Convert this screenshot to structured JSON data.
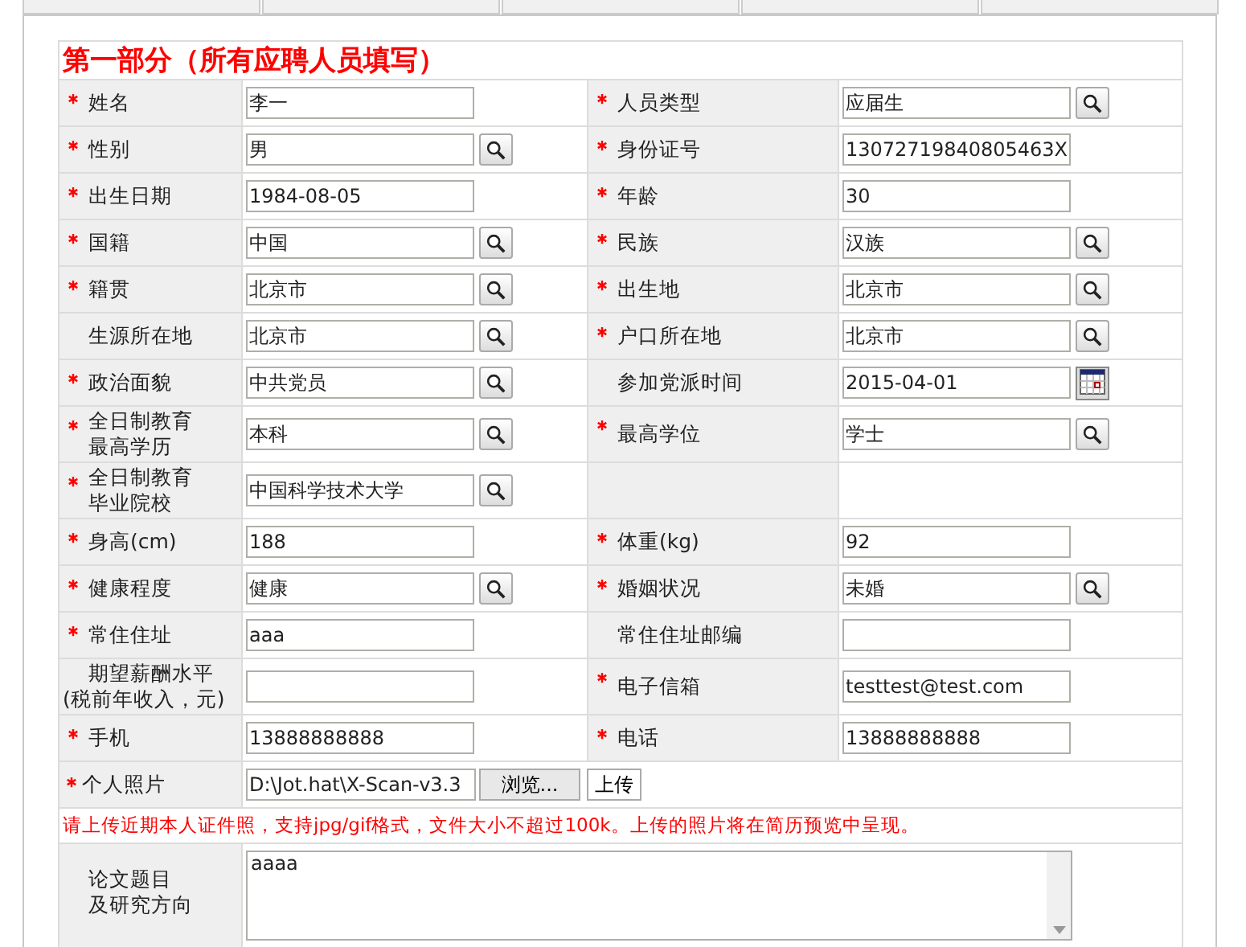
{
  "section_title": "第一部分（所有应聘人员填写）",
  "rows": [
    {
      "cells": [
        {
          "label": [
            "姓名"
          ],
          "required": true,
          "kind": "text",
          "value": "李一"
        },
        {
          "label": [
            "人员类型"
          ],
          "required": true,
          "kind": "lookup",
          "value": "应届生"
        }
      ]
    },
    {
      "cells": [
        {
          "label": [
            "性别"
          ],
          "required": true,
          "kind": "lookup",
          "value": "男"
        },
        {
          "label": [
            "身份证号"
          ],
          "required": true,
          "kind": "text",
          "value": "13072719840805463X"
        }
      ]
    },
    {
      "cells": [
        {
          "label": [
            "出生日期"
          ],
          "required": true,
          "kind": "text",
          "value": "1984-08-05"
        },
        {
          "label": [
            "年龄"
          ],
          "required": true,
          "kind": "text",
          "value": "30"
        }
      ]
    },
    {
      "cells": [
        {
          "label": [
            "国籍"
          ],
          "required": true,
          "kind": "lookup",
          "value": "中国"
        },
        {
          "label": [
            "民族"
          ],
          "required": true,
          "kind": "lookup",
          "value": "汉族"
        }
      ]
    },
    {
      "cells": [
        {
          "label": [
            "籍贯"
          ],
          "required": true,
          "kind": "lookup",
          "value": "北京市"
        },
        {
          "label": [
            "出生地"
          ],
          "required": true,
          "kind": "lookup",
          "value": "北京市"
        }
      ]
    },
    {
      "cells": [
        {
          "label": [
            "生源所在地"
          ],
          "required": false,
          "kind": "lookup",
          "value": "北京市"
        },
        {
          "label": [
            "户口所在地"
          ],
          "required": true,
          "kind": "lookup",
          "value": "北京市"
        }
      ]
    },
    {
      "cells": [
        {
          "label": [
            "政治面貌"
          ],
          "required": true,
          "kind": "lookup",
          "value": "中共党员"
        },
        {
          "label": [
            "参加党派时间"
          ],
          "required": false,
          "kind": "date",
          "value": "2015-04-01"
        }
      ]
    },
    {
      "cells": [
        {
          "label": [
            "全日制教育",
            "最高学历"
          ],
          "required": true,
          "kind": "lookup",
          "value": "本科"
        },
        {
          "label": [
            "最高学位"
          ],
          "required": true,
          "kind": "lookup",
          "value": "学士"
        }
      ]
    },
    {
      "cells": [
        {
          "label": [
            "全日制教育",
            "毕业院校"
          ],
          "required": true,
          "kind": "lookup",
          "value": "中国科学技术大学"
        },
        {
          "kind": "empty"
        }
      ]
    },
    {
      "cells": [
        {
          "label": [
            "身高(cm)"
          ],
          "required": true,
          "kind": "text",
          "value": "188"
        },
        {
          "label": [
            "体重(kg)"
          ],
          "required": true,
          "kind": "text",
          "value": "92"
        }
      ]
    },
    {
      "cells": [
        {
          "label": [
            "健康程度"
          ],
          "required": true,
          "kind": "lookup",
          "value": "健康"
        },
        {
          "label": [
            "婚姻状况"
          ],
          "required": true,
          "kind": "lookup",
          "value": "未婚"
        }
      ]
    },
    {
      "cells": [
        {
          "label": [
            "常住住址"
          ],
          "required": true,
          "kind": "text",
          "value": "aaa"
        },
        {
          "label": [
            "常住住址邮编"
          ],
          "required": false,
          "kind": "text"
        }
      ]
    },
    {
      "cells": [
        {
          "label": [
            "期望薪酬水平(税前年收入，元)"
          ],
          "required": false,
          "kind": "text"
        },
        {
          "label": [
            "电子信箱"
          ],
          "required": true,
          "kind": "text",
          "value": "testtest@test.com"
        }
      ]
    },
    {
      "cells": [
        {
          "label": [
            "手机"
          ],
          "required": true,
          "kind": "text",
          "value": "13888888888"
        },
        {
          "label": [
            "电话"
          ],
          "required": true,
          "kind": "text",
          "value": "13888888888"
        }
      ]
    }
  ],
  "photo": {
    "label": "个人照片",
    "required": true,
    "file_value": "D:\\Jot.hat\\X-Scan-v3.3",
    "browse_button": "浏览...",
    "upload_button": "上传"
  },
  "notice": "请上传近期本人证件照，支持jpg/gif格式，文件大小不超过100k。上传的照片将在简历预览中呈现。",
  "thesis": {
    "label": [
      "论文题目",
      "及研究方向"
    ],
    "value": "aaaa"
  }
}
